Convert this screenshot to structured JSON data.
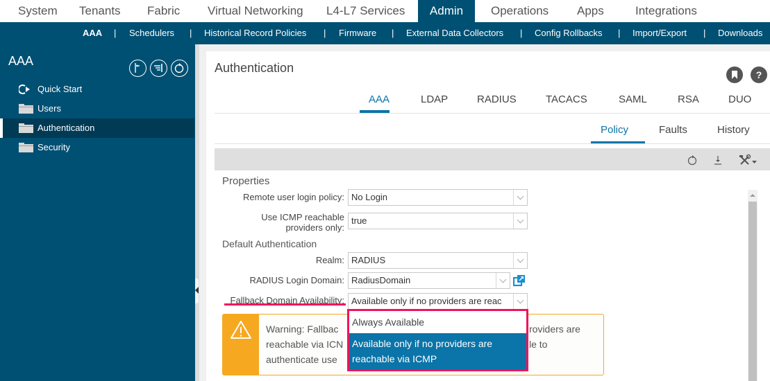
{
  "topnav": {
    "items": [
      "System",
      "Tenants",
      "Fabric",
      "Virtual Networking",
      "L4-L7 Services",
      "Admin",
      "Operations",
      "Apps",
      "Integrations"
    ],
    "active": "Admin"
  },
  "subnav": {
    "items": [
      "AAA",
      "Schedulers",
      "Historical Record Policies",
      "Firmware",
      "External Data Collectors",
      "Config Rollbacks",
      "Import/Export",
      "Downloads"
    ],
    "separator": "|",
    "active": "AAA"
  },
  "sidebar": {
    "title": "AAA",
    "header_icons": [
      "collapse-all-icon",
      "filter-list-icon",
      "refresh-icon"
    ],
    "items": [
      {
        "label": "Quick Start",
        "icon": "quick-start-icon"
      },
      {
        "label": "Users",
        "icon": "folder-icon"
      },
      {
        "label": "Authentication",
        "icon": "folder-icon",
        "active": true
      },
      {
        "label": "Security",
        "icon": "folder-icon"
      }
    ]
  },
  "main": {
    "title": "Authentication",
    "header_icons": [
      "bookmark-icon",
      "help-icon"
    ],
    "tabs": [
      "AAA",
      "LDAP",
      "RADIUS",
      "TACACS",
      "SAML",
      "RSA",
      "DUO"
    ],
    "active_tab": "AAA",
    "subtabs": [
      "Policy",
      "Faults",
      "History"
    ],
    "active_subtab": "Policy",
    "toolbar_icons": [
      "refresh-icon",
      "download-icon",
      "tools-icon"
    ],
    "properties": {
      "title": "Properties",
      "remote_login": {
        "label": "Remote user login policy:",
        "value": "No Login"
      },
      "icmp": {
        "label_line1": "Use ICMP reachable",
        "label_line2": "providers only:",
        "value": "true"
      }
    },
    "default_auth": {
      "title": "Default Authentication",
      "realm": {
        "label": "Realm:",
        "value": "RADIUS"
      },
      "radius_domain": {
        "label": "RADIUS Login Domain:",
        "value": "RadiusDomain"
      },
      "fallback": {
        "label": "Fallback Domain Availability:",
        "value": "Available only if no providers are reac"
      }
    },
    "dropdown": {
      "options": [
        "Always Available",
        "Available only if no providers are reachable via ICMP"
      ],
      "option2_line1": "Available only if no providers are",
      "option2_line2": "reachable via ICMP",
      "selected": "Available only if no providers are reachable via ICMP"
    },
    "warning": {
      "line1_left": "Warning: Fallbac",
      "line1_right": "roviders are",
      "line2_left": "reachable via ICN",
      "line2_right": "le to",
      "line3_left": "authenticate use"
    }
  },
  "colors": {
    "brand": "#005073",
    "accent": "#0b74a8",
    "highlight": "#f0145a",
    "warning": "#f6a821"
  }
}
